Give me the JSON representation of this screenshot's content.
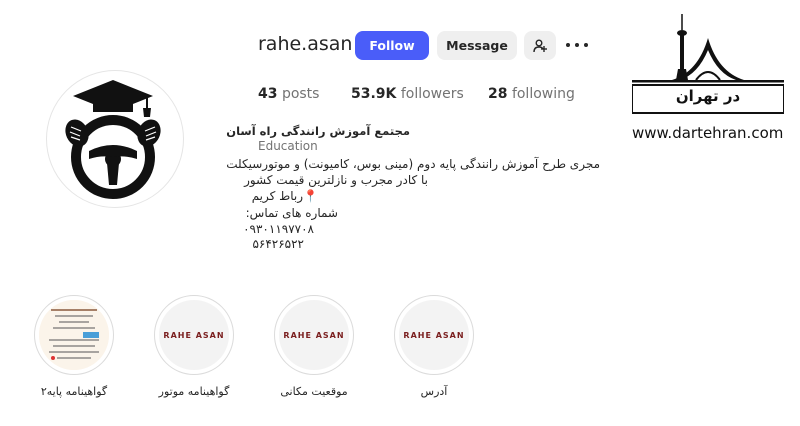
{
  "profile": {
    "username": "rahe.asan",
    "follow_label": "Follow",
    "message_label": "Message",
    "add_icon": "person-add-icon",
    "more_icon": "more-icon",
    "avatar_icon": "graduation-cap-steering-wheel-icon"
  },
  "stats": {
    "posts_count": "43",
    "posts_label": "posts",
    "followers_count": "53.9K",
    "followers_label": "followers",
    "following_count": "28",
    "following_label": "following"
  },
  "bio": {
    "name": "مجتمع آموزش رانندگی راه آسان",
    "category": "Education",
    "line1": "مجری طرح آموزش رانندگی پایه دوم (مینی بوس، کامیونت) و موتورسیکلت",
    "line2": "با کادر مجرب و نازلترین قیمت کشور",
    "line3": "📍رباط کریم",
    "line4": "شماره های تماس:",
    "line5": "۰۹۳۰۱۱۹۷۷۰۸",
    "line6": "۵۶۴۲۶۵۲۲"
  },
  "highlights": [
    {
      "label": "گواهینامه پایه۲",
      "thumb": "document-thumbnail"
    },
    {
      "label": "گواهینامه موتور",
      "brand": "RAHE ASAN"
    },
    {
      "label": "موقعیت مکانی",
      "brand": "RAHE ASAN"
    },
    {
      "label": "آدرس",
      "brand": "RAHE ASAN"
    }
  ],
  "watermark": {
    "title": "در تهران",
    "url": "www.dartehran.com",
    "icon": "milad-tower-azadi-icon"
  },
  "colors": {
    "follow_button": "#4a5df9",
    "secondary_button": "#efefef",
    "muted_text": "#737373",
    "brand_text": "#7a1e1e"
  }
}
